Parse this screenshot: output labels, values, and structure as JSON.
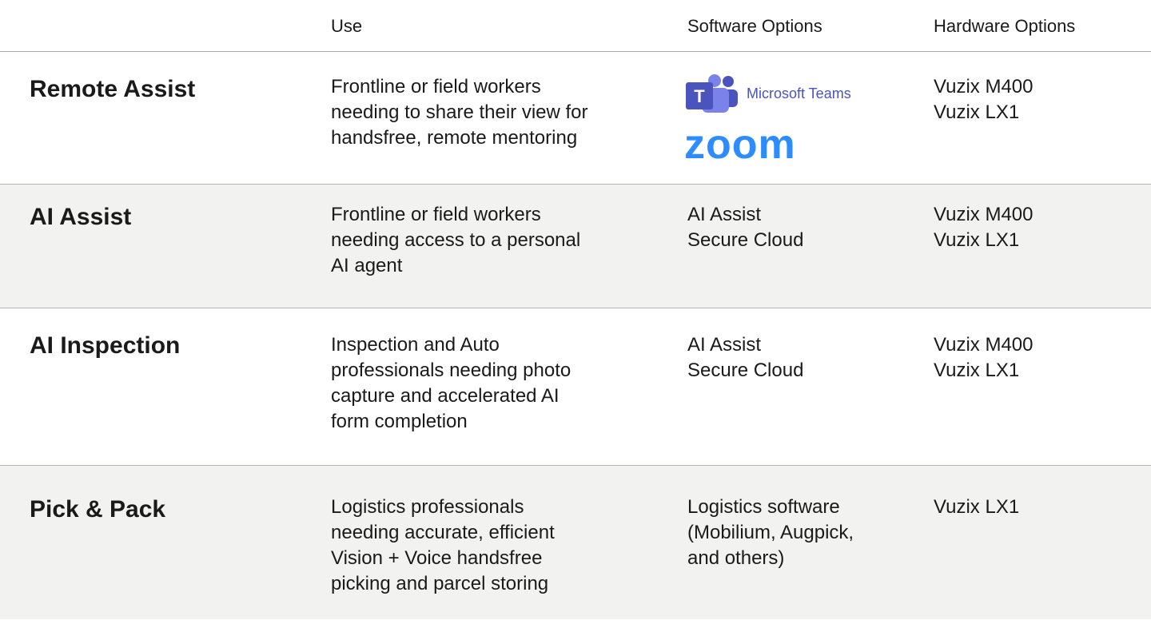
{
  "header": {
    "col1": "",
    "col2": "Use",
    "col3": "Software Options",
    "col4": "Hardware Options"
  },
  "rows": [
    {
      "title": "Remote Assist",
      "use": [
        "Frontline or field workers",
        "needing to share their view for",
        "handsfree, remote mentoring"
      ],
      "software": [],
      "software_logos": [
        "Microsoft Teams",
        "zoom"
      ],
      "hardware": [
        "Vuzix M400",
        "Vuzix LX1"
      ]
    },
    {
      "title": "AI Assist",
      "use": [
        "Frontline or field workers",
        "needing access to a personal",
        "AI agent"
      ],
      "software": [
        "AI Assist",
        "Secure Cloud"
      ],
      "hardware": [
        "Vuzix M400",
        "Vuzix LX1"
      ]
    },
    {
      "title": "AI Inspection",
      "use": [
        "Inspection and Auto",
        "professionals needing photo",
        "capture and accelerated AI",
        "form completion"
      ],
      "software": [
        "AI Assist",
        "Secure Cloud"
      ],
      "hardware": [
        "Vuzix M400",
        "Vuzix LX1"
      ]
    },
    {
      "title": "Pick & Pack",
      "use": [
        "Logistics professionals",
        "needing accurate, efficient",
        "Vision + Voice handsfree",
        "picking and parcel storing"
      ],
      "software": [
        "Logistics software",
        "(Mobilium, Augpick,",
        "and others)"
      ],
      "hardware": [
        "Vuzix LX1"
      ]
    }
  ],
  "colors": {
    "teams_purple": "#4b53bc",
    "teams_light": "#7b83eb",
    "zoom_blue": "#2d8cff",
    "alt_row_bg": "#f2f2f0",
    "divider": "#b4b4b4"
  },
  "icons": {
    "teams": "microsoft-teams-logo",
    "zoom": "zoom-logo"
  }
}
